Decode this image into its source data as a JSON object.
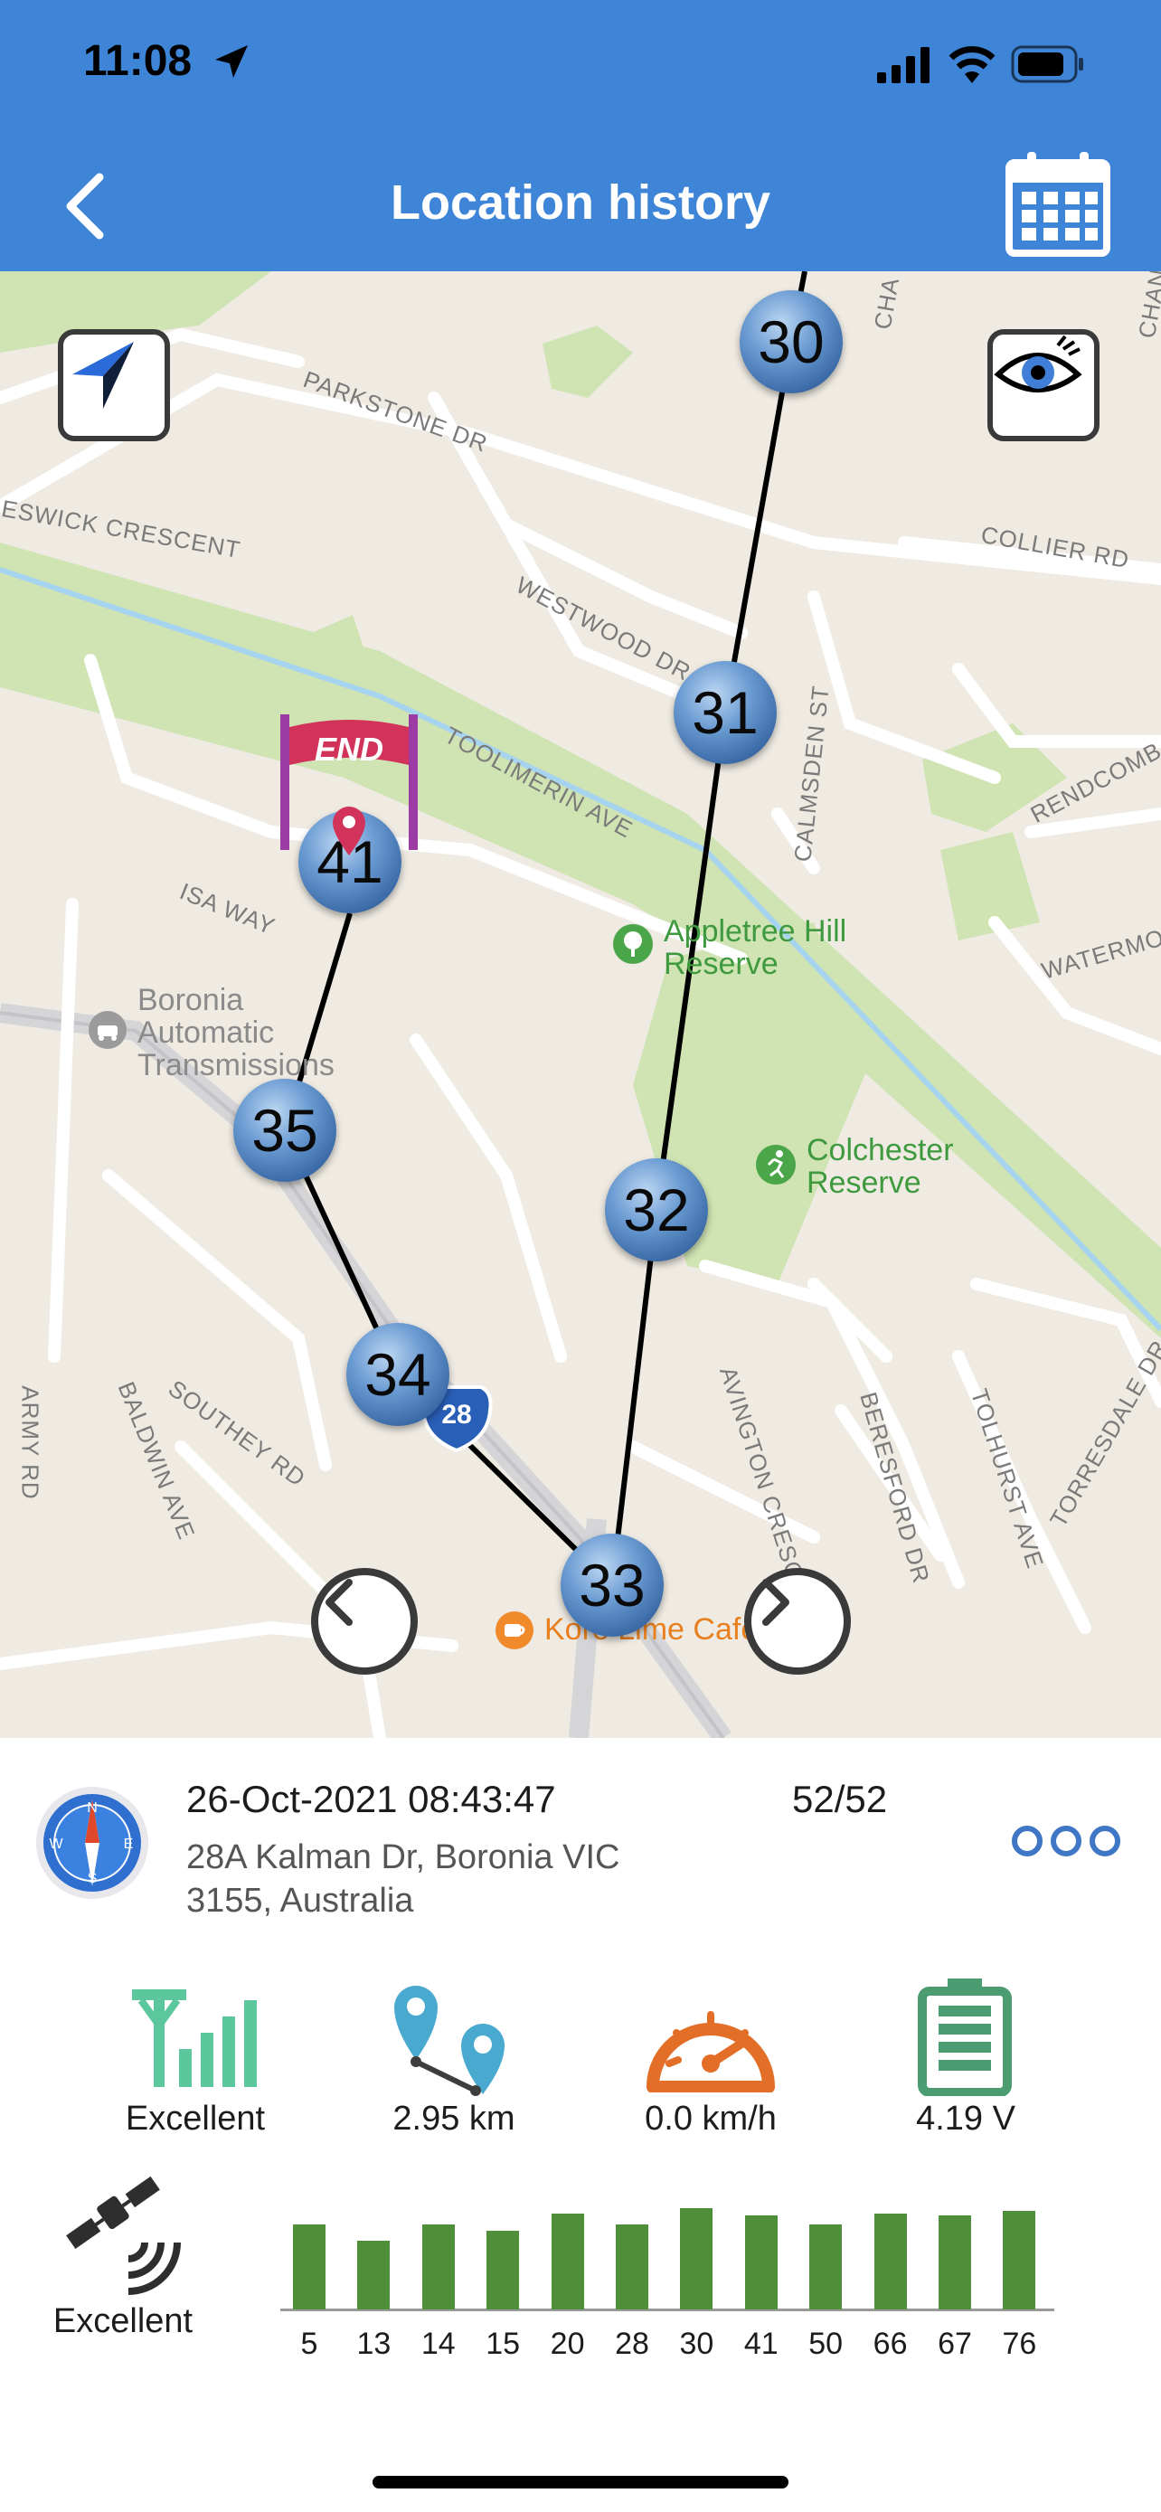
{
  "status_bar": {
    "time": "11:08"
  },
  "header": {
    "title": "Location history"
  },
  "map": {
    "markers": [
      {
        "label": "30"
      },
      {
        "label": "31"
      },
      {
        "label": "32"
      },
      {
        "label": "33"
      },
      {
        "label": "34"
      },
      {
        "label": "35"
      },
      {
        "label": "41"
      }
    ],
    "end_banner": "END",
    "street_labels": [
      "PARKSTONE DR",
      "ESWICK CRESCENT",
      "WESTWOOD DR",
      "TOOLIMERIN AVE",
      "COLLIER RD",
      "CALMSDEN ST",
      "RENDCOMB ST",
      "WATERMO",
      "ISA WAY",
      "SOUTHEY RD",
      "BALDWIN AVE",
      "AVINGTON CRESCENT",
      "BERESFORD DR",
      "TOLHURST AVE",
      "TORRESDALE DR",
      "ARMY RD",
      "CHA",
      "CHAN"
    ],
    "pois": [
      {
        "name": "Appletree Hill Reserve"
      },
      {
        "name": "Colchester Reserve"
      },
      {
        "name": "Boronia Automatic Transmissions"
      },
      {
        "name": "Kore Lime Cafe"
      }
    ],
    "shield": "28"
  },
  "info": {
    "datetime": "26-Oct-2021 08:43:47",
    "count": "52/52",
    "address": "28A Kalman Dr, Boronia VIC 3155, Australia"
  },
  "stats": {
    "signal": "Excellent",
    "distance": "2.95 km",
    "speed": "0.0 km/h",
    "battery": "4.19 V",
    "gps": "Excellent"
  },
  "satellites": {
    "labels": [
      "5",
      "13",
      "14",
      "15",
      "20",
      "28",
      "30",
      "41",
      "50",
      "66",
      "67",
      "76"
    ],
    "strength": [
      0.84,
      0.68,
      0.84,
      0.78,
      0.95,
      0.84,
      1.0,
      0.93,
      0.84,
      0.95,
      0.93,
      0.97
    ]
  },
  "colors": {
    "header": "#3e85d8",
    "bar": "#4f8f3a",
    "signal": "#5cc79c",
    "speed": "#e36e27",
    "battery": "#4b9c70"
  }
}
